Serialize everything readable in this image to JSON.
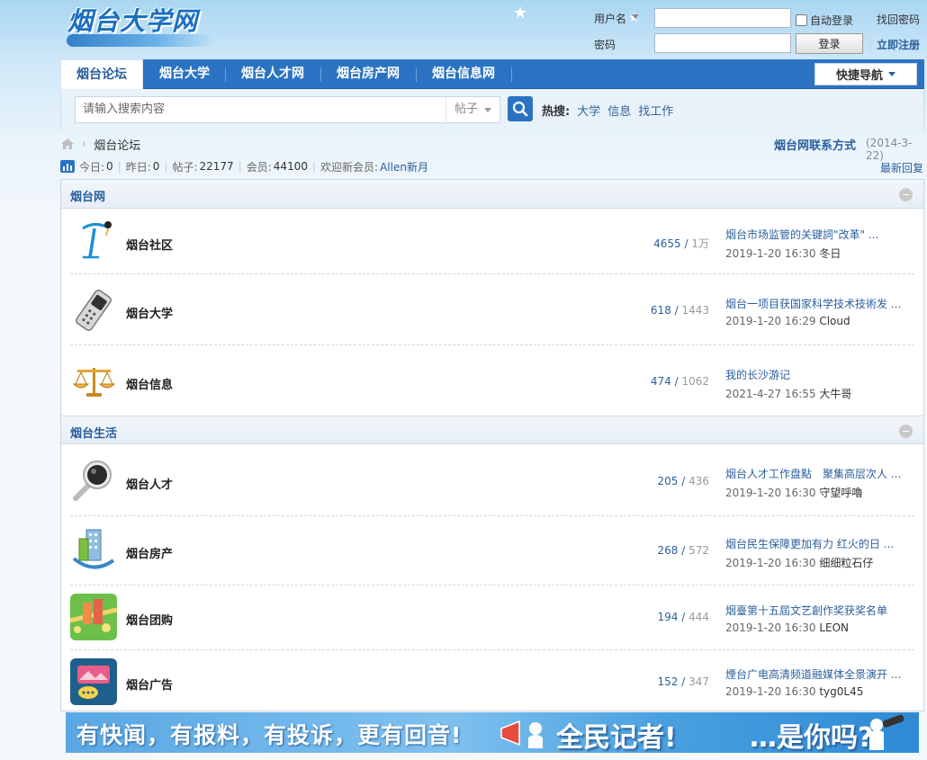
{
  "site": {
    "logo": "烟台大学网"
  },
  "login": {
    "username_label": "用户名",
    "password_label": "密码",
    "auto_login": "自动登录",
    "login_button": "登录",
    "find_password": "找回密码",
    "register": "立即注册"
  },
  "nav": {
    "items": [
      "烟台论坛",
      "烟台大学",
      "烟台人才网",
      "烟台房产网",
      "烟台信息网"
    ],
    "quick_nav": "快捷导航"
  },
  "search": {
    "placeholder": "请输入搜索内容",
    "type": "帖子",
    "hot_label": "热搜:",
    "hot_items": [
      "大学",
      "信息",
      "找工作"
    ]
  },
  "breadcrumb": {
    "current": "烟台论坛"
  },
  "contact": {
    "link": "烟台网联系方式",
    "date": "(2014-3-22)"
  },
  "stats": {
    "today_label": "今日:",
    "today": "0",
    "yesterday_label": "昨日:",
    "yesterday": "0",
    "posts_label": "帖子:",
    "posts": "22177",
    "members_label": "会员:",
    "members": "44100",
    "welcome_label": "欢迎新会员:",
    "new_member": "Allen新月",
    "latest_reply": "最新回复"
  },
  "categories": [
    {
      "title": "烟台网",
      "forums": [
        {
          "name": "烟台社区",
          "threads": "4655",
          "total": "1万",
          "last_title": "烟台市场监管的关键詞\"改革\" ...",
          "last_time": "2019-1-20 16:30",
          "last_user": "冬日",
          "icon": "pen-figure-icon"
        },
        {
          "name": "烟台大学",
          "threads": "618",
          "total": "1443",
          "last_title": "烟台一项目获国家科学技术技術发 ...",
          "last_time": "2019-1-20 16:29",
          "last_user": "Cloud",
          "icon": "mobile-phone-icon"
        },
        {
          "name": "烟台信息",
          "threads": "474",
          "total": "1062",
          "last_title": "我的长沙游记",
          "last_time": "2021-4-27 16:55",
          "last_user": "大牛哥",
          "icon": "scales-icon"
        }
      ]
    },
    {
      "title": "烟台生活",
      "forums": [
        {
          "name": "烟台人才",
          "threads": "205",
          "total": "436",
          "last_title": "烟台人才工作盘點　聚集高层次人 ...",
          "last_time": "2019-1-20 16:30",
          "last_user": "守望呼嚕",
          "icon": "magnifier-icon"
        },
        {
          "name": "烟台房产",
          "threads": "268",
          "total": "572",
          "last_title": "烟台民生保障更加有力 红火的日 ...",
          "last_time": "2019-1-20 16:30",
          "last_user": "细细粒石仔",
          "icon": "building-icon"
        },
        {
          "name": "烟台团购",
          "threads": "194",
          "total": "444",
          "last_title": "烟臺第十五屆文艺創作奖获奖名单",
          "last_time": "2019-1-20 16:30",
          "last_user": "LEON",
          "icon": "city-map-icon"
        },
        {
          "name": "烟台广告",
          "threads": "152",
          "total": "347",
          "last_title": "煙台广电高清频道融媒体全景演开 ...",
          "last_time": "2019-1-20 16:30",
          "last_user": "tyg0L45",
          "icon": "ad-chat-icon"
        }
      ]
    }
  ],
  "banner": {
    "text1": "有快闻，有报料，有投诉，更有回音!",
    "text2": "全民记者!",
    "text3": "…是你吗?"
  },
  "colors": {
    "nav_blue": "#2b73c2",
    "link_blue": "#2b5f9c"
  }
}
